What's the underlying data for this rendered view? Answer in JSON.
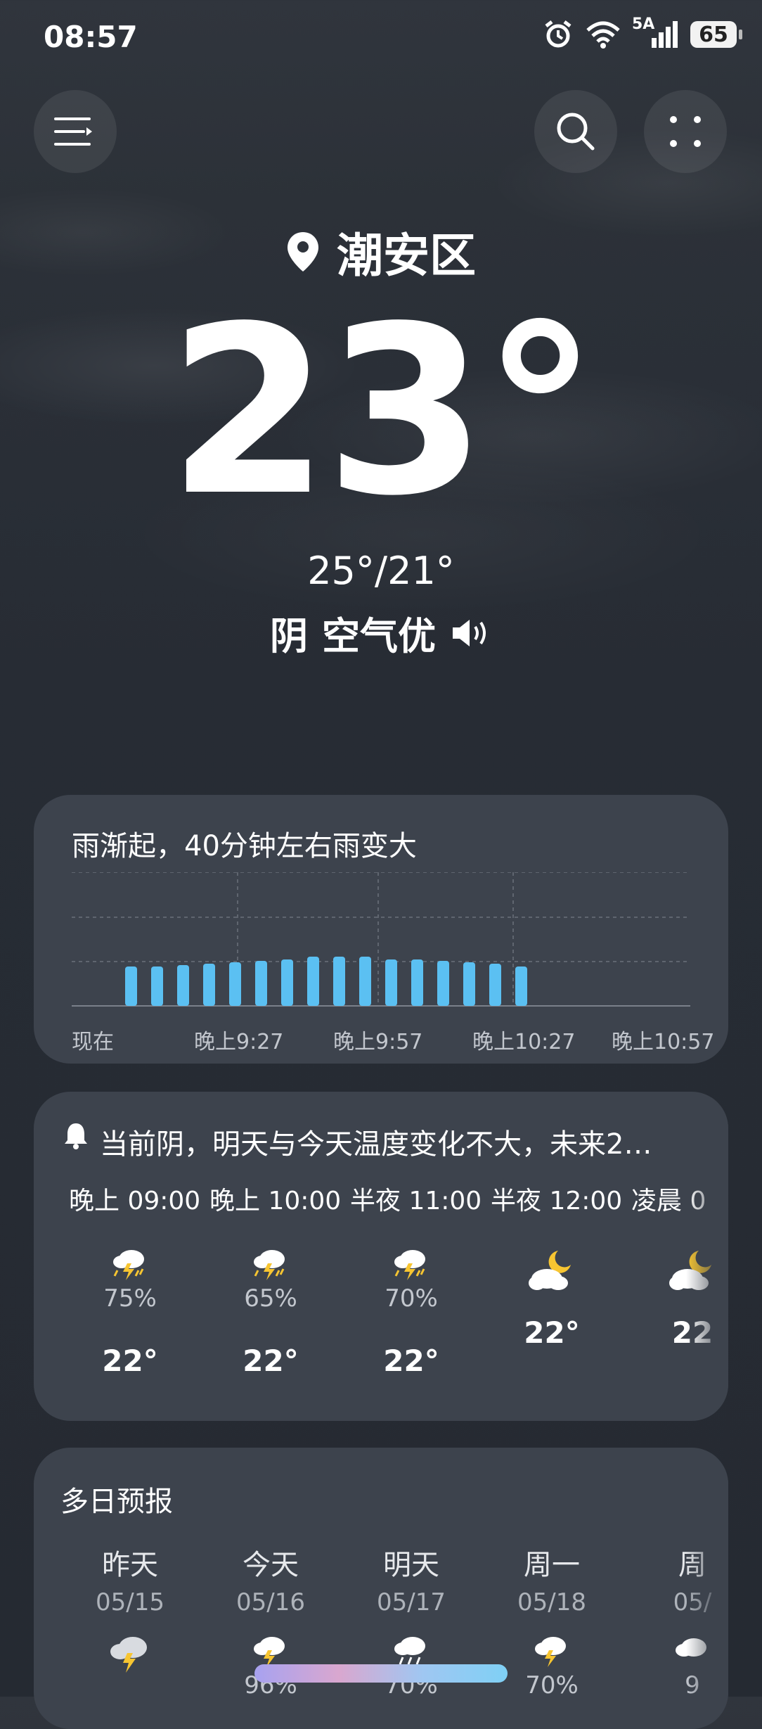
{
  "status": {
    "time": "08:57",
    "network": "5A",
    "battery": "65"
  },
  "location": {
    "city": "潮安区"
  },
  "current": {
    "temp": "23°",
    "range": "25°/21°",
    "condition": "阴",
    "air": "空气优"
  },
  "rain": {
    "title": "雨渐起，40分钟左右雨变大",
    "labels": [
      "现在",
      "晚上9:27",
      "晚上9:57",
      "晚上10:27",
      "晚上10:57"
    ],
    "accent": "#5bc0f2"
  },
  "hourly": {
    "summary": "当前阴，明天与今天温度变化不大，未来2…",
    "times": [
      "晚上 09:00",
      "晚上 10:00",
      "半夜 11:00",
      "半夜 12:00",
      "凌晨 0"
    ],
    "items": [
      {
        "icon": "thunder-rain-icon",
        "precip": "75%",
        "temp": "22°"
      },
      {
        "icon": "thunder-rain-icon",
        "precip": "65%",
        "temp": "22°"
      },
      {
        "icon": "thunder-rain-icon",
        "precip": "70%",
        "temp": "22°"
      },
      {
        "icon": "moon-cloud-icon",
        "precip": "",
        "temp": "22°"
      },
      {
        "icon": "moon-cloud-icon",
        "precip": "",
        "temp": "22"
      }
    ]
  },
  "daily": {
    "title": "多日预报",
    "days": [
      {
        "day": "昨天",
        "date": "05/15",
        "precip": "",
        "icon": "thunder-rain-icon"
      },
      {
        "day": "今天",
        "date": "05/16",
        "precip": "96%",
        "icon": "thunder-rain-icon"
      },
      {
        "day": "明天",
        "date": "05/17",
        "precip": "70%",
        "icon": "rain-cloud-icon"
      },
      {
        "day": "周一",
        "date": "05/18",
        "precip": "70%",
        "icon": "thunder-rain-icon"
      },
      {
        "day": "周",
        "date": "05/",
        "precip": "9",
        "icon": "cloud-icon"
      }
    ]
  }
}
